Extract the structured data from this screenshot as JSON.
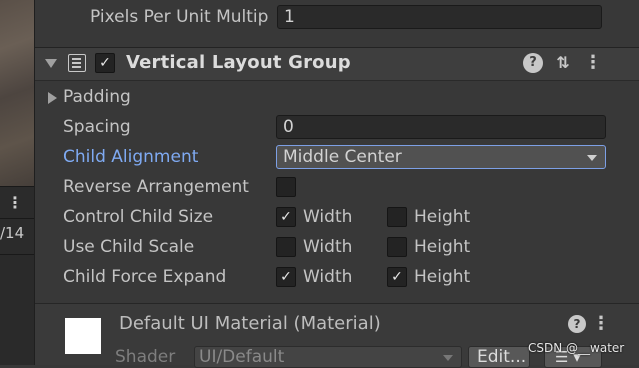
{
  "top_row": {
    "label": "Pixels Per Unit Multip",
    "value": "1"
  },
  "scene_strip": {
    "menu_glyph": "⋮",
    "number_text": "/14"
  },
  "component": {
    "title": "Vertical Layout Group",
    "enabled": true,
    "icons": [
      "help-icon",
      "preset-icon",
      "more-icon"
    ],
    "help_glyph": "?",
    "preset_glyph": "⇅",
    "more_glyph": "⋮"
  },
  "properties": {
    "padding_label": "Padding",
    "spacing_label": "Spacing",
    "spacing_value": "0",
    "child_alignment_label": "Child Alignment",
    "child_alignment_value": "Middle Center",
    "reverse_arrangement_label": "Reverse Arrangement",
    "reverse_arrangement_checked": false,
    "control_child_size_label": "Control Child Size",
    "use_child_scale_label": "Use Child Scale",
    "child_force_expand_label": "Child Force Expand",
    "width_label": "Width",
    "height_label": "Height",
    "control_child_size": {
      "width": true,
      "height": false
    },
    "use_child_scale": {
      "width": false,
      "height": false
    },
    "child_force_expand": {
      "width": true,
      "height": true
    }
  },
  "material": {
    "title": "Default UI Material (Material)",
    "shader_label": "Shader",
    "shader_value": "UI/Default",
    "edit_label": "Edit...",
    "list_glyph": "☰ ▾",
    "help_glyph": "?",
    "more_glyph": "⋮"
  },
  "watermark": "CSDN @__water",
  "colors": {
    "background": "#383838",
    "highlight_label": "#7faaf2",
    "dropdown_border": "#7da0e6"
  }
}
